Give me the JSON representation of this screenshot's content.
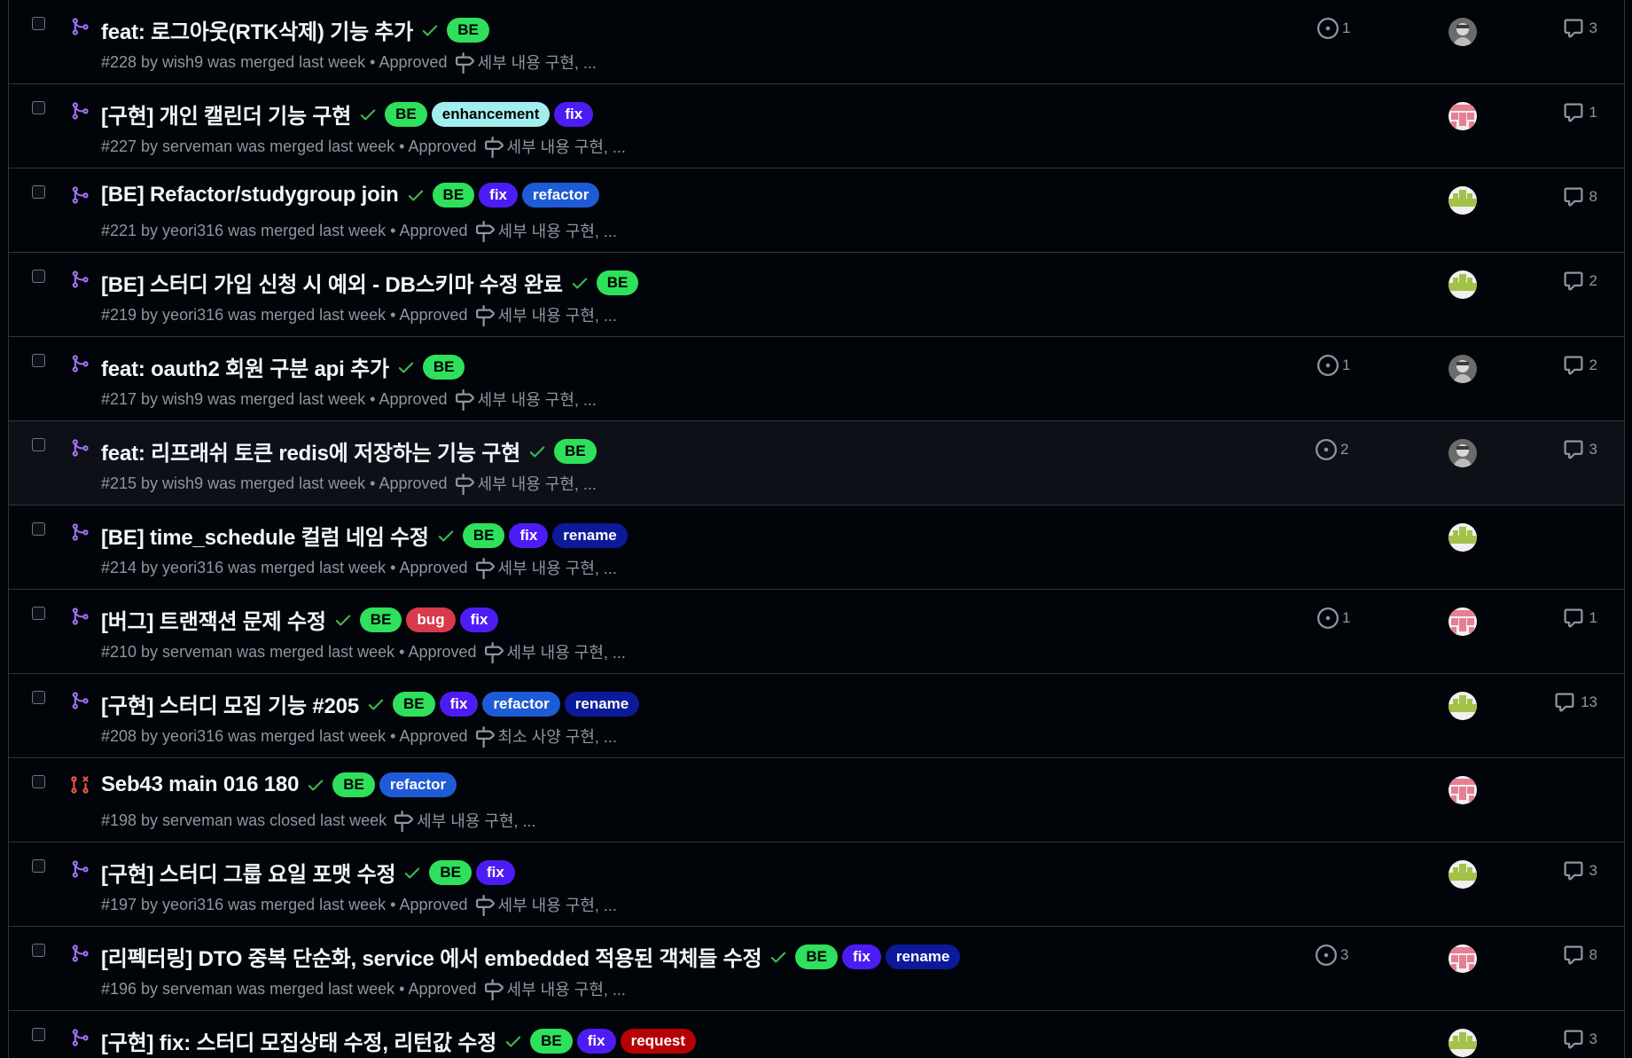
{
  "colors": {
    "background": "#010409",
    "border": "#30363d",
    "merged": "#a371f7",
    "closed": "#f85149",
    "approved_check": "#3fb950"
  },
  "label_styles": {
    "BE": {
      "bg": "#2ee05b",
      "fg": "#000000"
    },
    "enhancement": {
      "bg": "#a2eeef",
      "fg": "#000000"
    },
    "fix": {
      "bg": "#4d1cf5",
      "fg": "#ffffff"
    },
    "refactor": {
      "bg": "#1e5bd6",
      "fg": "#ffffff"
    },
    "rename": {
      "bg": "#0c1a9a",
      "fg": "#ffffff"
    },
    "bug": {
      "bg": "#d73a4a",
      "fg": "#ffffff"
    },
    "request": {
      "bg": "#b60205",
      "fg": "#ffffff"
    }
  },
  "icons": {
    "merged": "git-merge-icon",
    "closed": "git-pull-request-closed-icon",
    "check": "check-icon",
    "milestone": "milestone-icon",
    "task": "issue-opened-icon",
    "comment": "comment-icon"
  },
  "pull_requests": [
    {
      "title": "feat: 로그아웃(RTK삭제) 기능 추가",
      "meta": "#228 by wish9 was merged last week • Approved",
      "milestone": "세부 내용 구현, ...",
      "labels": [
        "BE"
      ],
      "linked": "1",
      "avatar": "gray",
      "comments": "3",
      "state": "merged",
      "approved": true
    },
    {
      "title": "[구현] 개인 캘린더 기능 구현",
      "meta": "#227 by serveman was merged last week • Approved",
      "milestone": "세부 내용 구현, ...",
      "labels": [
        "BE",
        "enhancement",
        "fix"
      ],
      "linked": "",
      "avatar": "pink",
      "comments": "1",
      "state": "merged",
      "approved": true
    },
    {
      "title": "[BE] Refactor/studygroup join",
      "meta": "#221 by yeori316 was merged last week • Approved",
      "milestone": "세부 내용 구현, ...",
      "labels": [
        "BE",
        "fix",
        "refactor"
      ],
      "linked": "",
      "avatar": "green",
      "comments": "8",
      "state": "merged",
      "approved": true
    },
    {
      "title": "[BE] 스터디 가입 신청 시 예외 - DB스키마 수정 완료",
      "meta": "#219 by yeori316 was merged last week • Approved",
      "milestone": "세부 내용 구현, ...",
      "labels": [
        "BE"
      ],
      "linked": "",
      "avatar": "green",
      "comments": "2",
      "state": "merged",
      "approved": true
    },
    {
      "title": "feat: oauth2 회원 구분 api 추가",
      "meta": "#217 by wish9 was merged last week • Approved",
      "milestone": "세부 내용 구현, ...",
      "labels": [
        "BE"
      ],
      "linked": "1",
      "avatar": "gray",
      "comments": "2",
      "state": "merged",
      "approved": true
    },
    {
      "title": "feat: 리프래쉬 토큰 redis에 저장하는 기능 구현",
      "meta": "#215 by wish9 was merged last week • Approved",
      "milestone": "세부 내용 구현, ...",
      "labels": [
        "BE"
      ],
      "linked": "2",
      "avatar": "gray",
      "comments": "3",
      "state": "merged",
      "approved": true,
      "hover": true
    },
    {
      "title": "[BE] time_schedule 컬럼 네임 수정",
      "meta": "#214 by yeori316 was merged last week • Approved",
      "milestone": "세부 내용 구현, ...",
      "labels": [
        "BE",
        "fix",
        "rename"
      ],
      "linked": "",
      "avatar": "green",
      "comments": "",
      "state": "merged",
      "approved": true
    },
    {
      "title": "[버그] 트랜잭션 문제 수정",
      "meta": "#210 by serveman was merged last week • Approved",
      "milestone": "세부 내용 구현, ...",
      "labels": [
        "BE",
        "bug",
        "fix"
      ],
      "linked": "1",
      "avatar": "pink",
      "comments": "1",
      "state": "merged",
      "approved": true
    },
    {
      "title": "[구현] 스터디 모집 기능 #205",
      "meta": "#208 by yeori316 was merged last week • Approved",
      "milestone": "최소 사양 구현, ...",
      "labels": [
        "BE",
        "fix",
        "refactor",
        "rename"
      ],
      "linked": "",
      "avatar": "green",
      "comments": "13",
      "state": "merged",
      "approved": true
    },
    {
      "title": "Seb43 main 016 180",
      "meta": "#198 by serveman was closed last week",
      "milestone": "세부 내용 구현, ...",
      "labels": [
        "BE",
        "refactor"
      ],
      "linked": "",
      "avatar": "pink",
      "comments": "",
      "state": "closed",
      "approved": true
    },
    {
      "title": "[구현] 스터디 그룹 요일 포맷 수정",
      "meta": "#197 by yeori316 was merged last week • Approved",
      "milestone": "세부 내용 구현, ...",
      "labels": [
        "BE",
        "fix"
      ],
      "linked": "",
      "avatar": "green",
      "comments": "3",
      "state": "merged",
      "approved": true
    },
    {
      "title": "[리펙터링] DTO 중복 단순화, service 에서 embedded 적용된 객체들 수정",
      "meta": "#196 by serveman was merged last week • Approved",
      "milestone": "세부 내용 구현, ...",
      "labels": [
        "BE",
        "fix",
        "rename"
      ],
      "linked": "3",
      "avatar": "pink",
      "comments": "8",
      "state": "merged",
      "approved": true
    },
    {
      "title": "[구현] fix: 스터디 모집상태 수정, 리턴값 수정",
      "meta": "",
      "milestone": "",
      "labels": [
        "BE",
        "fix",
        "request"
      ],
      "linked": "",
      "avatar": "green",
      "comments": "3",
      "state": "merged",
      "approved": true
    }
  ]
}
